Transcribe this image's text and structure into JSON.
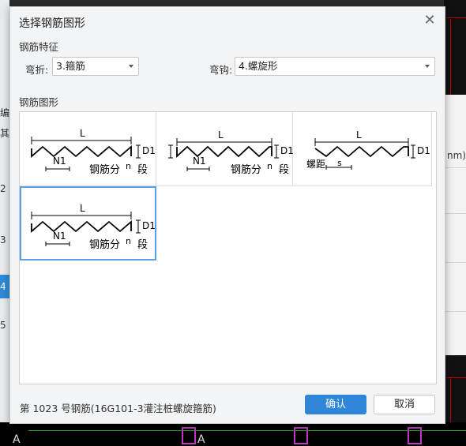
{
  "dialog": {
    "title": "选择钢筋图形",
    "close_glyph": "✕"
  },
  "features": {
    "section_label": "钢筋特征",
    "bend_label": "弯折:",
    "bend_value": "3.箍筋",
    "hook_label": "弯钩:",
    "hook_value": "4.螺旋形"
  },
  "shapes": {
    "section_label": "钢筋图形",
    "items": [
      {
        "L": "L",
        "D1": "D1",
        "N1": "N1",
        "text": "钢筋分",
        "n": "n",
        "seg": "段"
      },
      {
        "L": "L",
        "D1": "D1",
        "N1": "N1",
        "text": "钢筋分",
        "n": "n",
        "seg": "段"
      },
      {
        "L": "L",
        "D1": "D1",
        "pitch": "螺距",
        "s": "s"
      },
      {
        "L": "L",
        "D1": "D1",
        "N1": "N1",
        "text": "钢筋分",
        "n": "n",
        "seg": "段"
      }
    ]
  },
  "status": {
    "text": "第 1023 号钢筋(16G101-3灌注桩螺旋箍筋)"
  },
  "buttons": {
    "ok": "确认",
    "cancel": "取消"
  },
  "background": {
    "left_rows": [
      "2",
      "3",
      "4",
      "5"
    ],
    "right_label": "nm)",
    "bottom_letters": [
      "A",
      "A"
    ],
    "left_partial_1": "编",
    "left_partial_2": "其"
  },
  "colors": {
    "accent": "#2f86d8",
    "selection_border": "#5aa0e6",
    "cad_red": "#c00000"
  }
}
